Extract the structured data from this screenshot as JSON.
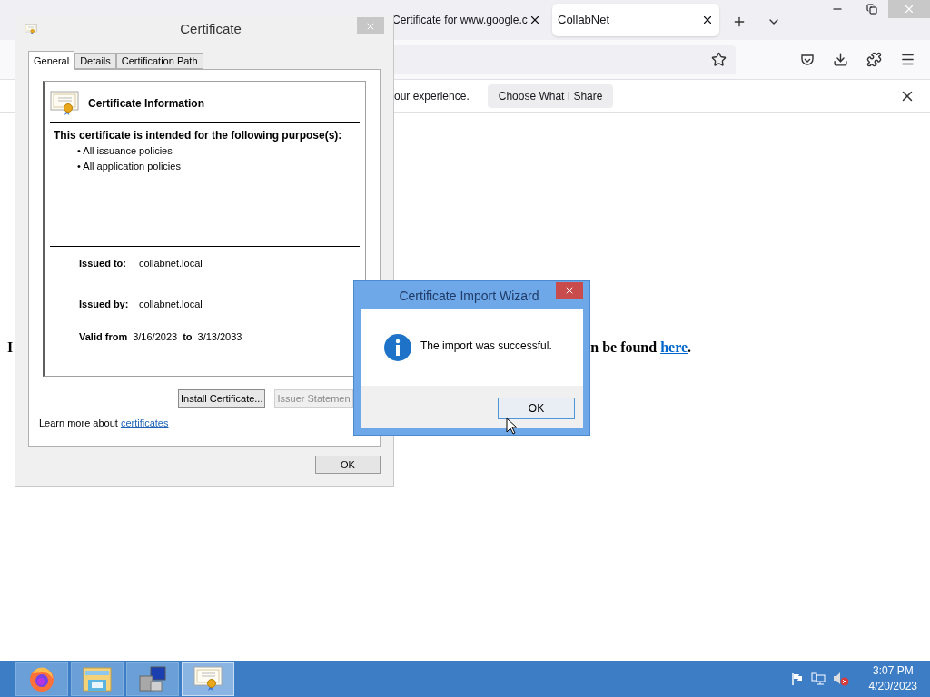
{
  "browser": {
    "tabs": [
      {
        "title": "Certificate for www.google.c",
        "selected": false
      },
      {
        "title": "CollabNet",
        "selected": true
      }
    ],
    "notification": {
      "message": "our experience.",
      "button": "Choose What I Share"
    },
    "page": {
      "paragraph_fragment": "I",
      "paragraph_tail": "n be found",
      "paragraph_link": "here",
      "paragraph_end": "."
    }
  },
  "certificate_dialog": {
    "title": "Certificate",
    "tabs": [
      {
        "label": "General",
        "selected": true
      },
      {
        "label": "Details",
        "selected": false
      },
      {
        "label": "Certification Path",
        "selected": false
      }
    ],
    "heading": "Certificate Information",
    "purpose_title": "This certificate is intended for the following purpose(s):",
    "purposes": [
      "• All issuance policies",
      "• All application policies"
    ],
    "fields": [
      {
        "label": "Issued to:",
        "value": "collabnet.local"
      },
      {
        "label": "Issued by:",
        "value": "collabnet.local"
      }
    ],
    "validity": {
      "from_label": "Valid from",
      "from": "3/16/2023",
      "to_label": "to",
      "to": "3/13/2033"
    },
    "buttons": [
      {
        "label": "Install Certificate...",
        "disabled": false
      },
      {
        "label": "Issuer Statemen",
        "disabled": true
      }
    ],
    "learn_more": {
      "text": "Learn more about",
      "link": "certificates"
    },
    "ok": "OK"
  },
  "wizard_dialog": {
    "title": "Certificate Import Wizard",
    "message": "The import was successful.",
    "ok": "OK"
  },
  "taskbar": {
    "apps": [
      {
        "kind": "firefox",
        "selected": false
      },
      {
        "kind": "explorer",
        "selected": false
      },
      {
        "kind": "server",
        "selected": false
      },
      {
        "kind": "certificate",
        "selected": true
      }
    ],
    "time": "3:07 PM",
    "date": "4/20/2023"
  }
}
